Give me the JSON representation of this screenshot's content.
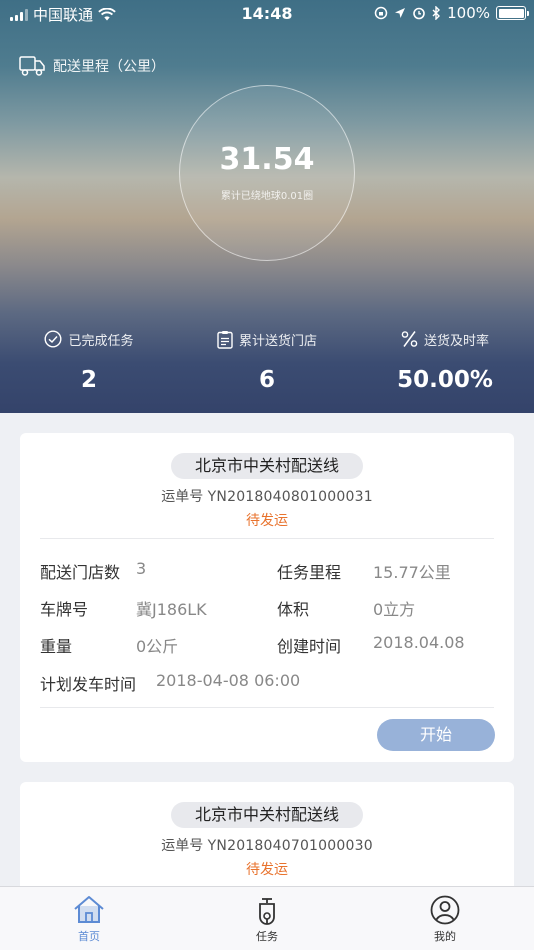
{
  "status_bar": {
    "carrier": "中国联通",
    "time": "14:48",
    "battery": "100%"
  },
  "hero": {
    "mileage_label": "配送里程（公里）",
    "mileage_value": "31.54",
    "mileage_sub": "累计已绕地球0.01圈",
    "stats": [
      {
        "label": "已完成任务",
        "value": "2",
        "icon": "check-circle-icon"
      },
      {
        "label": "累计送货门店",
        "value": "6",
        "icon": "clipboard-icon"
      },
      {
        "label": "送货及时率",
        "value": "50.00%",
        "icon": "percent-icon"
      }
    ]
  },
  "cards": [
    {
      "route": "北京市中关村配送线",
      "waybill_label": "运单号",
      "waybill_no": "YN2018040801000031",
      "status": "待发运",
      "fields": {
        "store_count_label": "配送门店数",
        "store_count": "3",
        "mileage_label": "任务里程",
        "mileage": "15.77公里",
        "plate_label": "车牌号",
        "plate": "冀J186LK",
        "volume_label": "体积",
        "volume": "0立方",
        "weight_label": "重量",
        "weight": "0公斤",
        "created_label": "创建时间",
        "created": "2018.04.08",
        "depart_label": "计划发车时间",
        "depart": "2018-04-08 06:00"
      },
      "start_button": "开始"
    },
    {
      "route": "北京市中关村配送线",
      "waybill_label": "运单号",
      "waybill_no": "YN2018040701000030",
      "status": "待发运"
    }
  ],
  "tabbar": {
    "tabs": [
      {
        "label": "首页",
        "icon": "home-icon"
      },
      {
        "label": "任务",
        "icon": "scooter-icon"
      },
      {
        "label": "我的",
        "icon": "user-icon"
      }
    ],
    "active_color": "#5d8bd4"
  },
  "colors": {
    "status_orange": "#e8732e",
    "button_blue": "#98b2d9"
  }
}
